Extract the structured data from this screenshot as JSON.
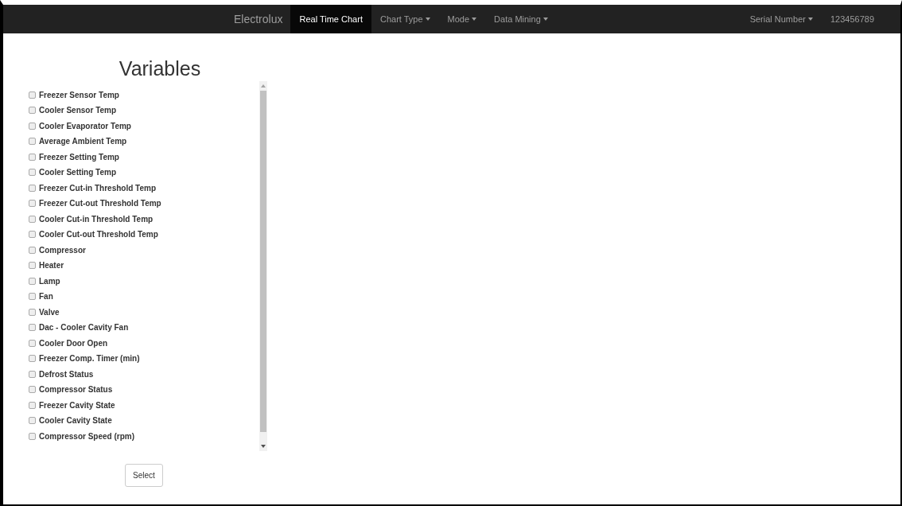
{
  "navbar": {
    "brand": "Electrolux",
    "items": [
      {
        "label": "Real Time Chart",
        "kind": "link",
        "selected": true
      },
      {
        "label": "Chart Type",
        "kind": "dropdown",
        "selected": false
      },
      {
        "label": "Mode",
        "kind": "dropdown",
        "selected": false
      },
      {
        "label": "Data Mining",
        "kind": "dropdown",
        "selected": false
      }
    ],
    "right_items": [
      {
        "label": "Serial Number",
        "kind": "dropdown",
        "selected": false
      },
      {
        "label": "123456789",
        "kind": "link",
        "selected": false
      }
    ]
  },
  "panel": {
    "title": "Variables",
    "variables": [
      {
        "label": "Freezer Sensor Temp",
        "checked": false
      },
      {
        "label": "Cooler Sensor Temp",
        "checked": false
      },
      {
        "label": "Cooler Evaporator Temp",
        "checked": false
      },
      {
        "label": "Average Ambient Temp",
        "checked": false
      },
      {
        "label": "Freezer Setting Temp",
        "checked": false
      },
      {
        "label": "Cooler Setting Temp",
        "checked": false
      },
      {
        "label": "Freezer Cut-in Threshold Temp",
        "checked": false
      },
      {
        "label": "Freezer Cut-out Threshold Temp",
        "checked": false
      },
      {
        "label": "Cooler Cut-in Threshold Temp",
        "checked": false
      },
      {
        "label": "Cooler Cut-out Threshold Temp",
        "checked": false
      },
      {
        "label": "Compressor",
        "checked": false
      },
      {
        "label": "Heater",
        "checked": false
      },
      {
        "label": "Lamp",
        "checked": false
      },
      {
        "label": "Fan",
        "checked": false
      },
      {
        "label": "Valve",
        "checked": false
      },
      {
        "label": "Dac - Cooler Cavity Fan",
        "checked": false
      },
      {
        "label": "Cooler Door Open",
        "checked": false
      },
      {
        "label": "Freezer Comp. Timer (min)",
        "checked": false
      },
      {
        "label": "Defrost Status",
        "checked": false
      },
      {
        "label": "Compressor Status",
        "checked": false
      },
      {
        "label": "Freezer Cavity State",
        "checked": false
      },
      {
        "label": "Cooler Cavity State",
        "checked": false
      },
      {
        "label": "Compressor Speed (rpm)",
        "checked": false
      }
    ],
    "button": "Select"
  }
}
